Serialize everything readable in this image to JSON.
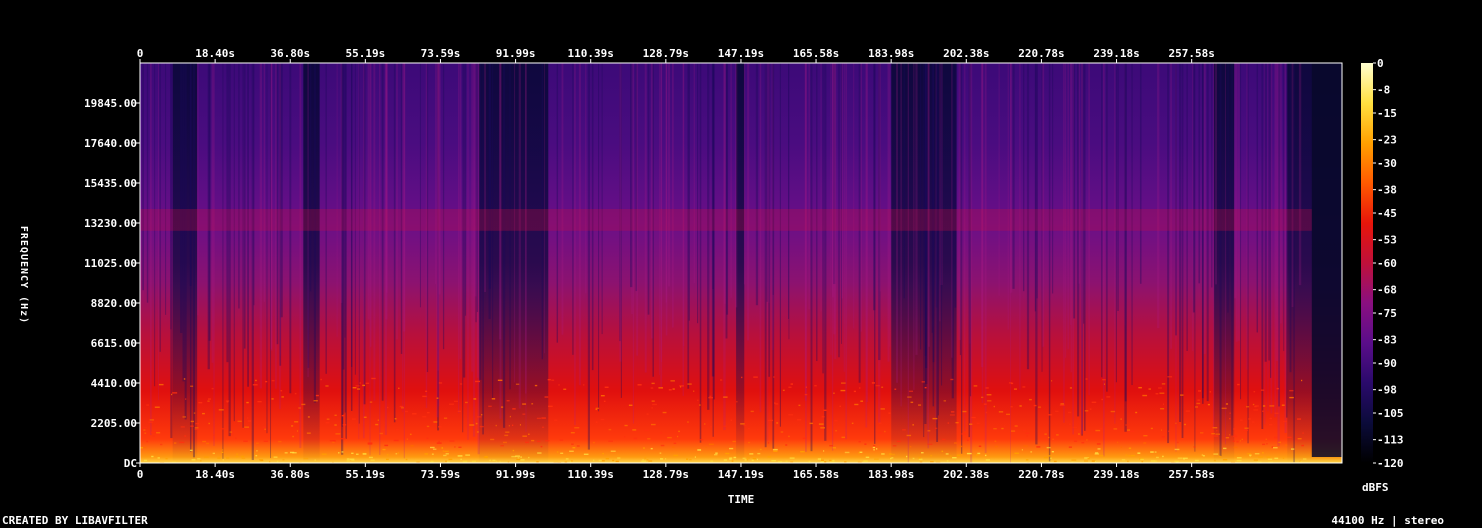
{
  "chart_data": {
    "type": "heatmap",
    "title": "",
    "xlabel": "TIME",
    "ylabel": "FREQUENCY (Hz)",
    "x_ticks": [
      "0",
      "18.40s",
      "36.80s",
      "55.19s",
      "73.59s",
      "91.99s",
      "110.39s",
      "128.79s",
      "147.19s",
      "165.58s",
      "183.98s",
      "202.38s",
      "220.78s",
      "239.18s",
      "257.58s"
    ],
    "x_tick_values": [
      0,
      18.4,
      36.8,
      55.19,
      73.59,
      91.99,
      110.39,
      128.79,
      147.19,
      165.58,
      183.98,
      202.38,
      220.78,
      239.18,
      257.58
    ],
    "xlim": [
      0,
      294.4
    ],
    "y_ticks": [
      "DC",
      "2205.00",
      "4410.00",
      "6615.00",
      "8820.00",
      "11025.00",
      "13230.00",
      "15435.00",
      "17640.00",
      "19845.00"
    ],
    "y_tick_values": [
      0,
      2205,
      4410,
      6615,
      8820,
      11025,
      13230,
      15435,
      17640,
      19845
    ],
    "ylim": [
      0,
      22050
    ],
    "colorbar": {
      "label": "dBFS",
      "ticks": [
        "0",
        "-8",
        "-15",
        "-23",
        "-30",
        "-38",
        "-45",
        "-53",
        "-60",
        "-68",
        "-75",
        "-83",
        "-90",
        "-98",
        "-105",
        "-113",
        "-120"
      ],
      "tick_values": [
        0,
        -8,
        -15,
        -23,
        -30,
        -38,
        -45,
        -53,
        -60,
        -68,
        -75,
        -83,
        -90,
        -98,
        -105,
        -113,
        -120
      ],
      "range": [
        -120,
        0
      ],
      "colors": [
        "#000000",
        "#0b0b3a",
        "#2a0a6b",
        "#5a0d8a",
        "#8a0f80",
        "#c0103a",
        "#e8150a",
        "#ff5a00",
        "#ffa000",
        "#ffe040",
        "#ffffd0"
      ]
    },
    "grid": false
  },
  "footer": {
    "credit": "CREATED BY LIBAVFILTER",
    "info": "44100 Hz | stereo"
  }
}
